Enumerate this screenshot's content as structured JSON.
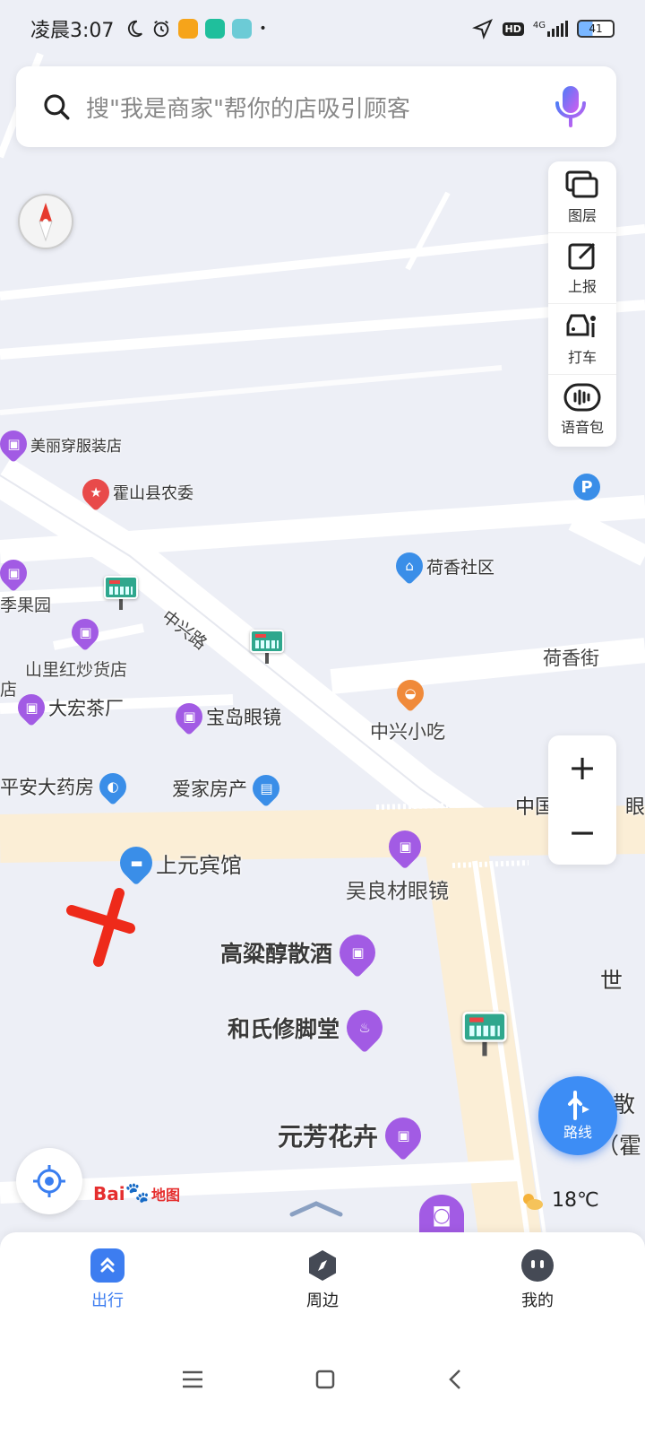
{
  "status_bar": {
    "time": "凌晨3:07",
    "network": "4G",
    "hd": "HD",
    "battery": "41",
    "battery_level": 0.41
  },
  "search": {
    "placeholder": "搜\"我是商家\"帮你的店吸引顾客"
  },
  "tools": [
    {
      "label": "图层",
      "icon": "layers-icon"
    },
    {
      "label": "上报",
      "icon": "report-icon"
    },
    {
      "label": "打车",
      "icon": "taxi-icon"
    },
    {
      "label": "语音包",
      "icon": "voice-pack-icon"
    }
  ],
  "zoom": {
    "in": "+",
    "out": "−"
  },
  "route": {
    "label": "路线"
  },
  "logo": {
    "bai": "Bai",
    "du": "du",
    "map": "地图"
  },
  "weather": {
    "temp": "18℃",
    "icon": "partly-sunny-icon"
  },
  "map": {
    "pois": {
      "meili": "美丽穿服装店",
      "nongwei": "霍山县农委",
      "jiguoyuan": "季果园",
      "shanli": "山里红炒货店",
      "dian": "店",
      "dahong": "大宏茶厂",
      "baodao": "宝岛眼镜",
      "anda": "平安大药房",
      "aijia": "爱家房产",
      "shangyuan": "上元宾馆",
      "wuliang": "吴良材眼镜",
      "heshang": "荷香社区",
      "zhongxing_snack": "中兴小吃",
      "gaoliang": "高粱醇散酒",
      "heshi": "和氏修脚堂",
      "yuanfang": "元芳花卉"
    },
    "roads": {
      "zhongxing_road": "中兴路",
      "hexiang_street": "荷香街"
    },
    "edge_text": {
      "zhongguo": "中国",
      "yanjing_cut": "眼",
      "shi": "世",
      "san": "散",
      "huo": "（霍"
    }
  },
  "bottom_nav": [
    {
      "label": "出行",
      "icon": "travel-icon",
      "active": true
    },
    {
      "label": "周边",
      "icon": "compass-nearby-icon",
      "active": false
    },
    {
      "label": "我的",
      "icon": "profile-icon",
      "active": false
    }
  ]
}
